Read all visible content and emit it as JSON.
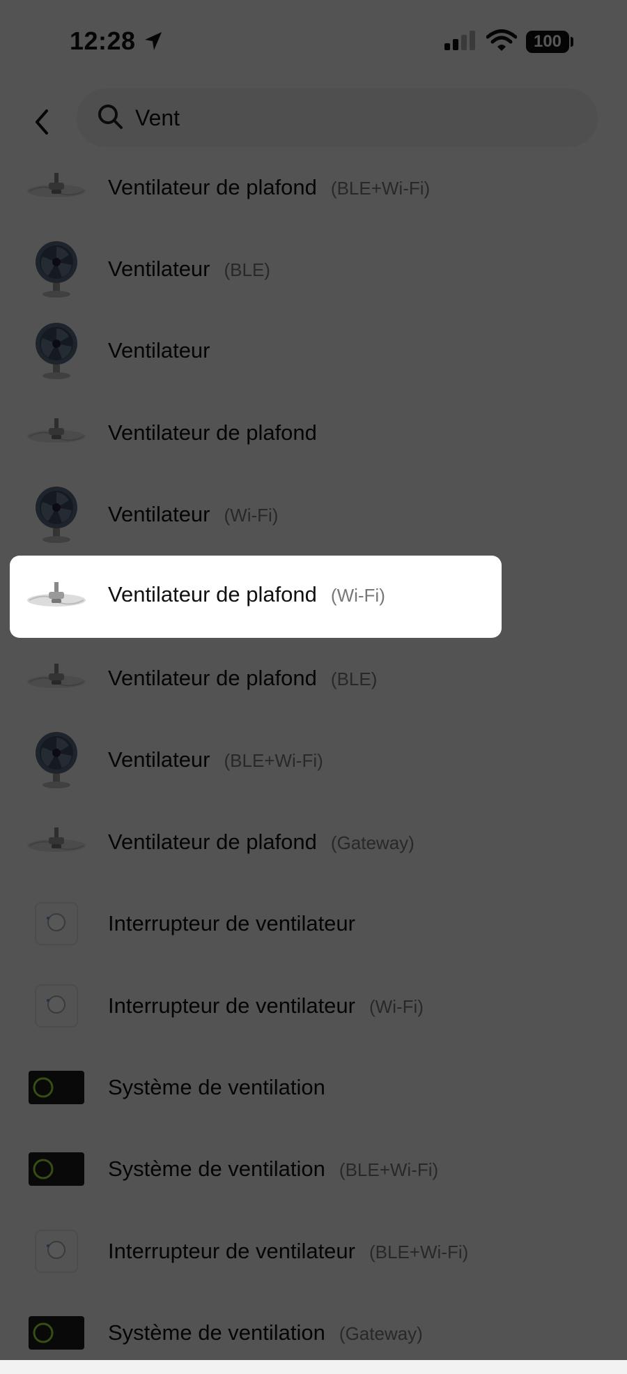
{
  "status": {
    "time": "12:28",
    "battery": "100"
  },
  "search": {
    "value": "Vent",
    "placeholder": ""
  },
  "items": [
    {
      "name": "Ventilateur de plafond",
      "tag": "(BLE+Wi-Fi)",
      "icon": "ceiling-fan"
    },
    {
      "name": "Ventilateur",
      "tag": "(BLE)",
      "icon": "desk-fan"
    },
    {
      "name": "Ventilateur",
      "tag": "",
      "icon": "desk-fan"
    },
    {
      "name": "Ventilateur de plafond",
      "tag": "",
      "icon": "ceiling-fan"
    },
    {
      "name": "Ventilateur",
      "tag": "(Wi-Fi)",
      "icon": "desk-fan"
    },
    {
      "name": "Ventilateur de plafond",
      "tag": "(Wi-Fi)",
      "icon": "ceiling-fan",
      "highlighted": true
    },
    {
      "name": "Ventilateur de plafond",
      "tag": "(BLE)",
      "icon": "ceiling-fan"
    },
    {
      "name": "Ventilateur",
      "tag": "(BLE+Wi-Fi)",
      "icon": "desk-fan"
    },
    {
      "name": "Ventilateur de plafond",
      "tag": "(Gateway)",
      "icon": "ceiling-fan"
    },
    {
      "name": "Interrupteur de ventilateur",
      "tag": "",
      "icon": "fan-switch"
    },
    {
      "name": "Interrupteur de ventilateur",
      "tag": "(Wi-Fi)",
      "icon": "fan-switch"
    },
    {
      "name": "Système de ventilation",
      "tag": "",
      "icon": "ventilation-system"
    },
    {
      "name": "Système de ventilation",
      "tag": "(BLE+Wi-Fi)",
      "icon": "ventilation-system"
    },
    {
      "name": "Interrupteur de ventilateur",
      "tag": "(BLE+Wi-Fi)",
      "icon": "fan-switch"
    },
    {
      "name": "Système de ventilation",
      "tag": "(Gateway)",
      "icon": "ventilation-system"
    }
  ]
}
